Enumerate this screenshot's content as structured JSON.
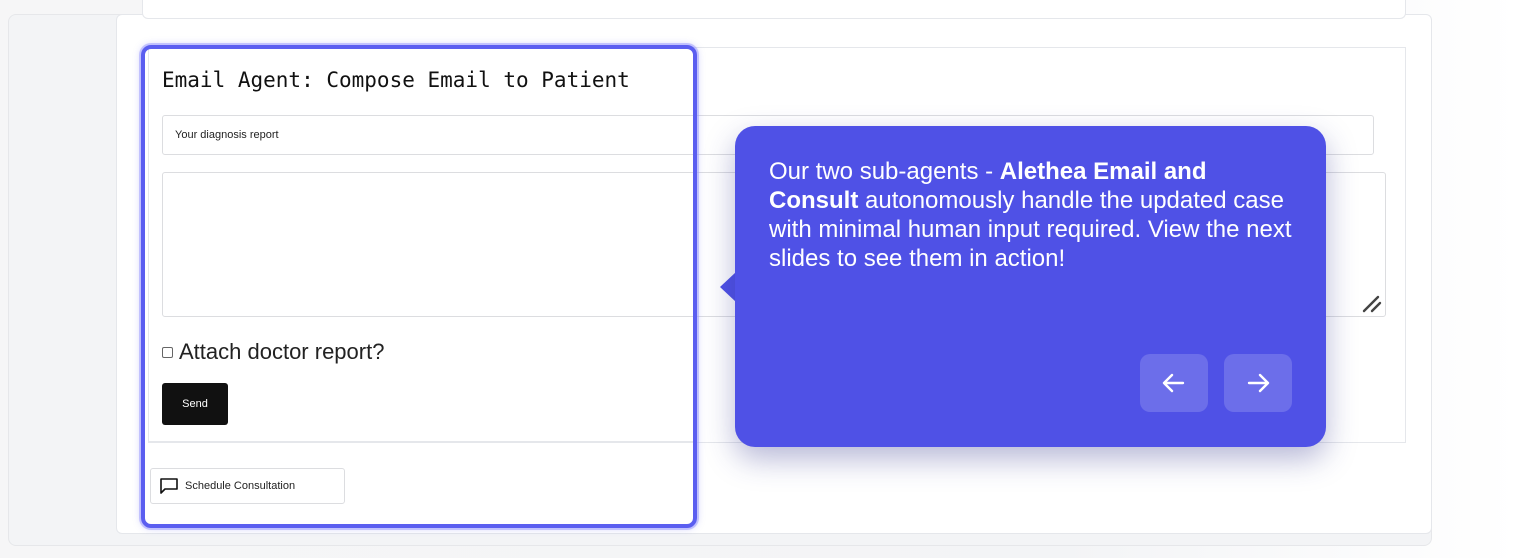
{
  "email_agent": {
    "title": "Email Agent: Compose Email to Patient",
    "subject_value": "Your diagnosis report",
    "body_value": "",
    "attach_label": "Attach doctor report?",
    "attach_checked": false,
    "send_label": "Send",
    "schedule_label": "Schedule Consultation"
  },
  "tour": {
    "text_before": "Our two sub-agents - ",
    "text_bold": "Alethea Email and Consult",
    "text_after": " autonomously handle the updated case with minimal human input required. View the next slides to see them in action!",
    "prev_icon": "arrow-left-icon",
    "next_icon": "arrow-right-icon",
    "accent_color": "#4f51e6",
    "highlight_color": "#5b5ef0"
  }
}
